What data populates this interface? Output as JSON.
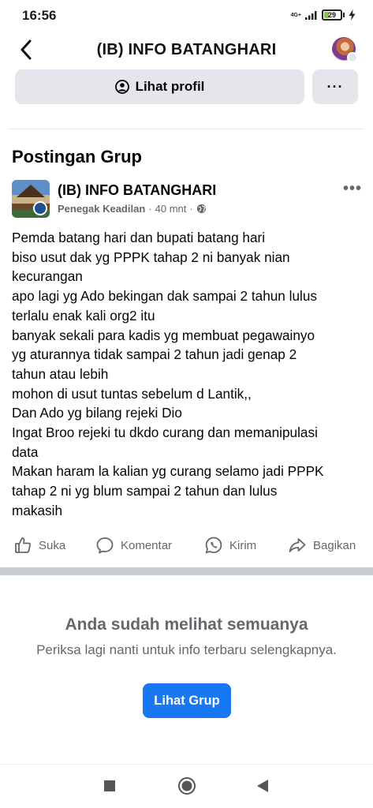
{
  "status_bar": {
    "time": "16:56",
    "network": "4G+",
    "battery": "29",
    "battery_level": 0.29,
    "battery_color": "#8bc34a"
  },
  "header": {
    "back_icon": "chevron-left-icon",
    "title": "(IB) INFO BATANGHARI"
  },
  "profile_actions": {
    "view_profile_label": "Lihat profil",
    "more_label": "···"
  },
  "section_title": "Postingan Grup",
  "post": {
    "group_name": "(IB) INFO BATANGHARI",
    "author": "Penegak Keadilan",
    "time": "40 mnt",
    "separator": "·",
    "privacy_icon": "globe-icon",
    "more_label": "•••",
    "lines": [
      "Pemda batang hari dan bupati batang hari",
      "biso usut dak yg PPPK tahap 2 ni banyak nian",
      "kecurangan",
      "apo lagi yg Ado bekingan dak sampai 2 tahun lulus",
      "terlalu enak kali org2 itu",
      "banyak sekali para kadis yg membuat pegawainyo",
      "yg aturannya tidak sampai 2 tahun jadi genap 2",
      "tahun atau lebih",
      "mohon di usut tuntas sebelum d Lantik,,",
      "Dan Ado yg bilang rejeki Dio",
      "Ingat Broo rejeki tu dkdo curang dan memanipulasi",
      "data",
      "Makan haram la kalian yg curang selamo jadi PPPK",
      "tahap 2 ni yg blum sampai 2 tahun dan lulus",
      "makasih"
    ],
    "actions": {
      "like": "Suka",
      "comment": "Komentar",
      "send": "Kirim",
      "share": "Bagikan"
    }
  },
  "end_of_feed": {
    "title": "Anda sudah melihat semuanya",
    "subtitle": "Periksa lagi nanti untuk info terbaru selengkapnya.",
    "button": "Lihat Grup"
  },
  "colors": {
    "accent": "#1877f2",
    "secondary_text": "#65676b",
    "button_gray": "#e4e6eb"
  }
}
